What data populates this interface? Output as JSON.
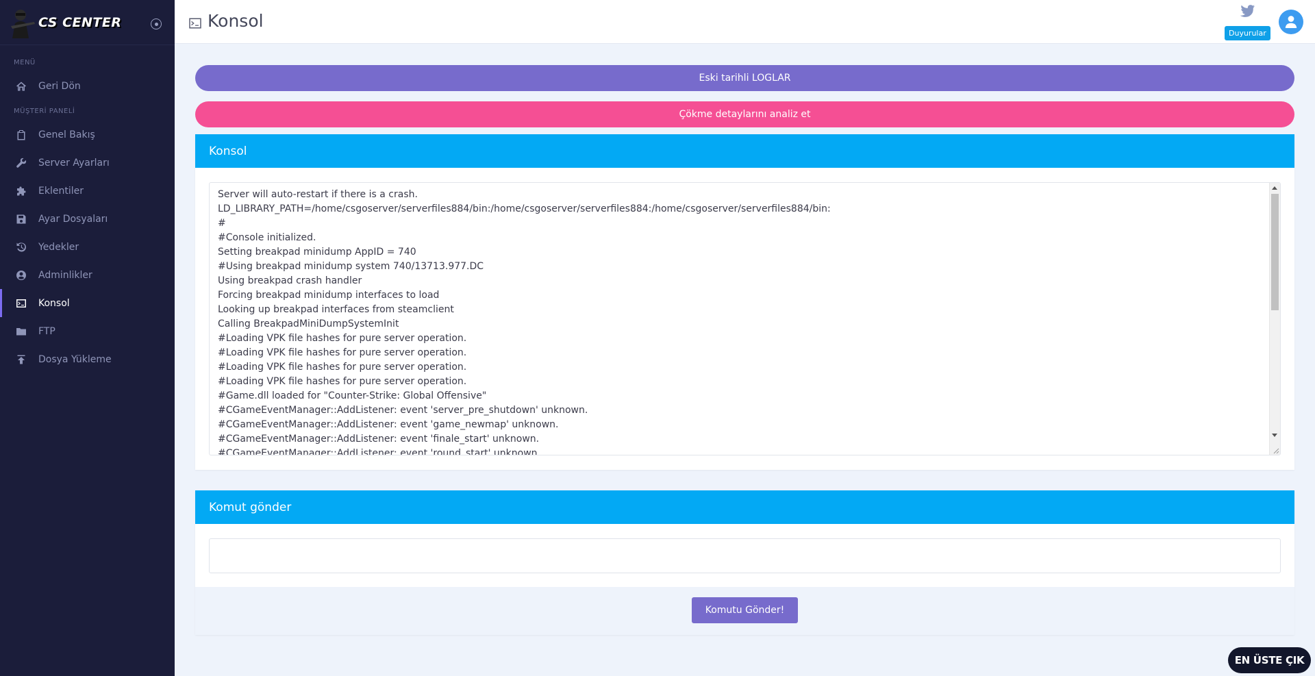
{
  "brand": {
    "name": "CS CENTER"
  },
  "sidebar": {
    "sections": {
      "menu": "MENÜ",
      "panel": "MÜŞTERİ PANELİ"
    },
    "items": [
      {
        "label": "Geri Dön",
        "icon": "home-icon"
      },
      {
        "label": "Genel Bakış",
        "icon": "clipboard-icon"
      },
      {
        "label": "Server Ayarları",
        "icon": "wrench-icon"
      },
      {
        "label": "Eklentiler",
        "icon": "puzzle-icon"
      },
      {
        "label": "Ayar Dosyaları",
        "icon": "save-icon"
      },
      {
        "label": "Yedekler",
        "icon": "history-icon"
      },
      {
        "label": "Adminlikler",
        "icon": "user-circle-icon"
      },
      {
        "label": "Konsol",
        "icon": "terminal-icon",
        "active": true
      },
      {
        "label": "FTP",
        "icon": "folder-icon"
      },
      {
        "label": "Dosya Yükleme",
        "icon": "upload-icon"
      }
    ]
  },
  "header": {
    "title": "Konsol",
    "announcements_label": "Duyurular"
  },
  "actions": {
    "old_logs_label": "Eski tarihli LOGLAR",
    "crash_analysis_label": "Çökme detaylarını analiz et"
  },
  "console": {
    "title": "Konsol",
    "lines": [
      "Server will auto-restart if there is a crash.",
      "LD_LIBRARY_PATH=/home/csgoserver/serverfiles884/bin:/home/csgoserver/serverfiles884:/home/csgoserver/serverfiles884/bin:",
      "#",
      "#Console initialized.",
      "Setting breakpad minidump AppID = 740",
      "#Using breakpad minidump system 740/13713.977.DC",
      "Using breakpad crash handler",
      "Forcing breakpad minidump interfaces to load",
      "Looking up breakpad interfaces from steamclient",
      "Calling BreakpadMiniDumpSystemInit",
      "#Loading VPK file hashes for pure server operation.",
      "#Loading VPK file hashes for pure server operation.",
      "#Loading VPK file hashes for pure server operation.",
      "#Loading VPK file hashes for pure server operation.",
      "#Game.dll loaded for \"Counter-Strike: Global Offensive\"",
      "#CGameEventManager::AddListener: event 'server_pre_shutdown' unknown.",
      "#CGameEventManager::AddListener: event 'game_newmap' unknown.",
      "#CGameEventManager::AddListener: event 'finale_start' unknown.",
      "#CGameEventManager::AddListener: event 'round_start' unknown."
    ]
  },
  "command": {
    "title": "Komut gönder",
    "input_value": "",
    "send_label": "Komutu Gönder!"
  },
  "scroll_top_label": "EN ÜSTE ÇIK",
  "colors": {
    "sidebar_bg": "#1b1d3a",
    "accent_purple": "#776bcc",
    "accent_pink": "#f54f94",
    "header_blue": "#03a9f4"
  }
}
